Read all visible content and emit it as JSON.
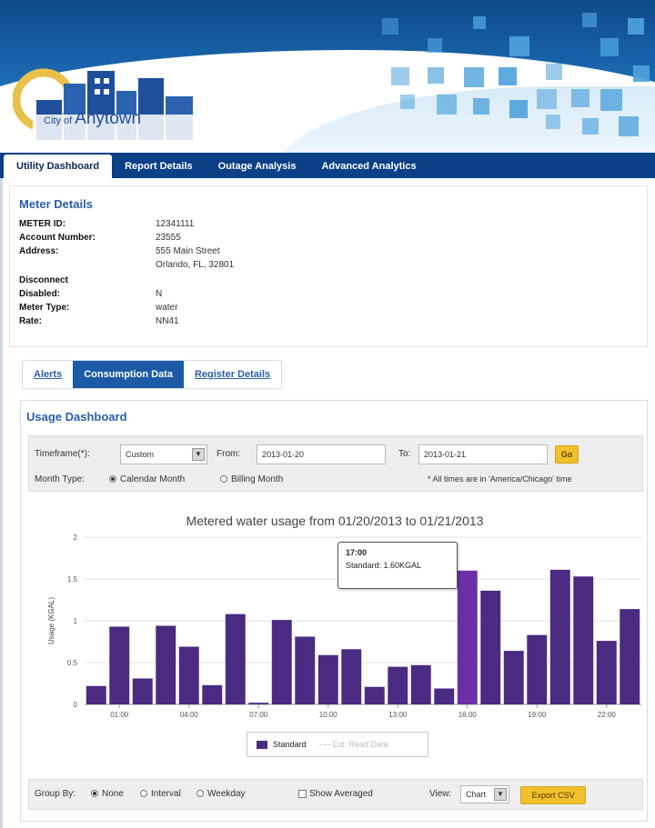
{
  "header": {
    "logo_city": "City of",
    "logo_name": "Anytown"
  },
  "nav": {
    "tabs": [
      "Utility Dashboard",
      "Report Details",
      "Outage Analysis",
      "Advanced Analytics"
    ],
    "active_index": 0
  },
  "meter_details": {
    "title": "Meter Details",
    "fields": [
      {
        "label": "METER ID:",
        "value": "12341111"
      },
      {
        "label": "Account Number:",
        "value": "23555"
      },
      {
        "label": "Address:",
        "value": "555 Main Street"
      },
      {
        "label": "",
        "value": "Orlando, FL, 32801"
      },
      {
        "label": "Disconnect",
        "value": ""
      },
      {
        "label": "Disabled:",
        "value": "N"
      },
      {
        "label": "Meter Type:",
        "value": "water"
      },
      {
        "label": "Rate:",
        "value": "NN41"
      }
    ]
  },
  "subtabs": {
    "items": [
      "Alerts",
      "Consumption Data",
      "Register Details"
    ],
    "active_index": 1
  },
  "usage": {
    "title": "Usage Dashboard",
    "timeframe_label": "Timeframe(*):",
    "timeframe_value": "Custom",
    "from_label": "From:",
    "from_value": "2013-01-20",
    "to_label": "To:",
    "to_value": "2013-01-21",
    "go_label": "Go",
    "month_type_label": "Month Type:",
    "calendar_month": "Calendar Month",
    "billing_month": "Billing Month",
    "times_note": "* All times are in 'America/Chicago' time",
    "group_by_label": "Group By:",
    "group_none": "None",
    "group_interval": "Interval",
    "group_weekday": "Weekday",
    "show_averaged": "Show Averaged",
    "view_label": "View:",
    "view_value": "Chart",
    "export_label": "Export CSV"
  },
  "tooltip": {
    "time": "17:00",
    "text": "Standard: 1.60KGAL"
  },
  "legend": {
    "standard": "Standard",
    "muted": "Est. Read Data"
  },
  "colors": {
    "bar": "#4b2a82",
    "bar_highlight": "#6b2fa8",
    "nav_bg": "#0b3f86",
    "accent": "#2a5fa8",
    "button": "#f2c02b"
  },
  "chart_data": {
    "type": "bar",
    "title": "Metered water usage from 01/20/2013 to 01/21/2013",
    "ylabel": "Usage (KGAL)",
    "xlabel": "",
    "ylim": [
      0,
      2
    ],
    "yticks": [
      "0",
      "0.5",
      "1",
      "1.5",
      "2"
    ],
    "xticks": [
      "01:00",
      "04:00",
      "07:00",
      "10:00",
      "13:00",
      "16:00",
      "19:00",
      "22:00"
    ],
    "categories": [
      "00:00",
      "01:00",
      "02:00",
      "03:00",
      "04:00",
      "05:00",
      "06:00",
      "07:00",
      "08:00",
      "09:00",
      "10:00",
      "11:00",
      "12:00",
      "13:00",
      "14:00",
      "15:00",
      "16:00",
      "17:00",
      "18:00",
      "19:00",
      "20:00",
      "21:00",
      "22:00",
      "23:00"
    ],
    "series": [
      {
        "name": "Standard",
        "values": [
          0.22,
          0.93,
          0.31,
          0.94,
          0.69,
          0.23,
          1.08,
          0.02,
          1.01,
          0.81,
          0.59,
          0.66,
          0.21,
          0.45,
          0.47,
          0.19,
          1.6,
          1.36,
          0.64,
          0.83,
          1.61,
          1.53,
          0.76,
          1.14
        ]
      }
    ],
    "highlight_index": 16,
    "grid": true,
    "legend_position": "bottom"
  }
}
